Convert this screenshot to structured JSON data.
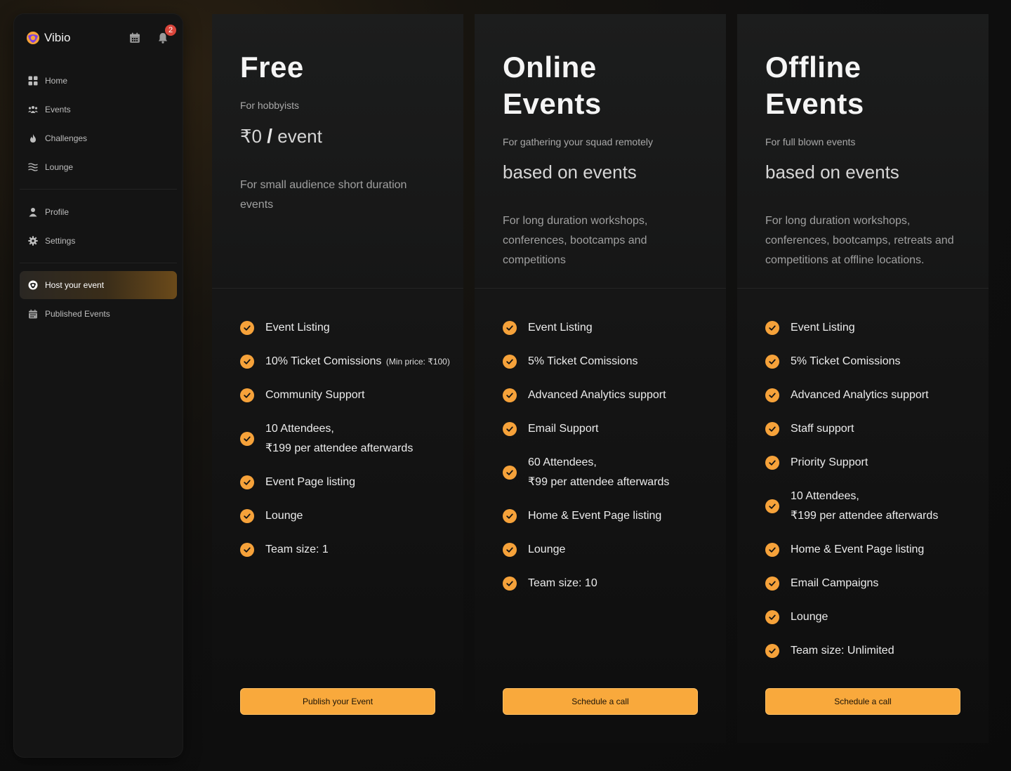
{
  "app": {
    "name": "Vibio",
    "notification_count": "2"
  },
  "sidebar": {
    "primary": [
      {
        "label": "Home",
        "icon": "grid-icon"
      },
      {
        "label": "Events",
        "icon": "people-icon"
      },
      {
        "label": "Challenges",
        "icon": "flame-icon"
      },
      {
        "label": "Lounge",
        "icon": "waves-icon"
      }
    ],
    "secondary": [
      {
        "label": "Profile",
        "icon": "user-icon"
      },
      {
        "label": "Settings",
        "icon": "gear-icon"
      }
    ],
    "host": [
      {
        "label": "Host your event",
        "icon": "host-icon",
        "active": true
      },
      {
        "label": "Published Events",
        "icon": "calendar-icon"
      }
    ]
  },
  "plans": [
    {
      "title": "Free",
      "subtitle": "For hobbyists",
      "price_amount": "₹0",
      "price_slash": "/",
      "price_unit": "event",
      "description": "For small audience short duration events",
      "features": [
        {
          "line1": "Event Listing"
        },
        {
          "line1": "10% Ticket Comissions",
          "note": "(Min price: ₹100)"
        },
        {
          "line1": "Community Support"
        },
        {
          "line1": "10 Attendees,",
          "line2": "₹199 per attendee afterwards"
        },
        {
          "line1": "Event Page listing"
        },
        {
          "line1": "Lounge"
        },
        {
          "line1": "Team size: 1"
        }
      ],
      "cta": "Publish your Event"
    },
    {
      "title": "Online Events",
      "subtitle": "For gathering your squad remotely",
      "price_text": "based on events",
      "description": "For long duration workshops, conferences, bootcamps and competitions",
      "features": [
        {
          "line1": "Event Listing"
        },
        {
          "line1": "5% Ticket Comissions"
        },
        {
          "line1": "Advanced Analytics support"
        },
        {
          "line1": "Email Support"
        },
        {
          "line1": "60 Attendees,",
          "line2": "₹99 per attendee afterwards"
        },
        {
          "line1": "Home & Event Page listing"
        },
        {
          "line1": "Lounge"
        },
        {
          "line1": "Team size: 10"
        }
      ],
      "cta": "Schedule a call"
    },
    {
      "title": "Offline Events",
      "subtitle": "For full blown events",
      "price_text": "based on events",
      "description": "For long duration workshops, conferences, bootcamps, retreats and competitions at offline locations.",
      "features": [
        {
          "line1": "Event Listing"
        },
        {
          "line1": "5% Ticket Comissions"
        },
        {
          "line1": "Advanced Analytics support"
        },
        {
          "line1": "Staff support"
        },
        {
          "line1": "Priority Support"
        },
        {
          "line1": "10 Attendees,",
          "line2": "₹199 per attendee afterwards"
        },
        {
          "line1": "Home & Event Page listing"
        },
        {
          "line1": "Email Campaigns"
        },
        {
          "line1": "Lounge"
        },
        {
          "line1": "Team size: Unlimited"
        }
      ],
      "cta": "Schedule a call"
    }
  ],
  "colors": {
    "accent": "#f6a23a",
    "button": "#f9a93c",
    "badge": "#d9453b"
  }
}
